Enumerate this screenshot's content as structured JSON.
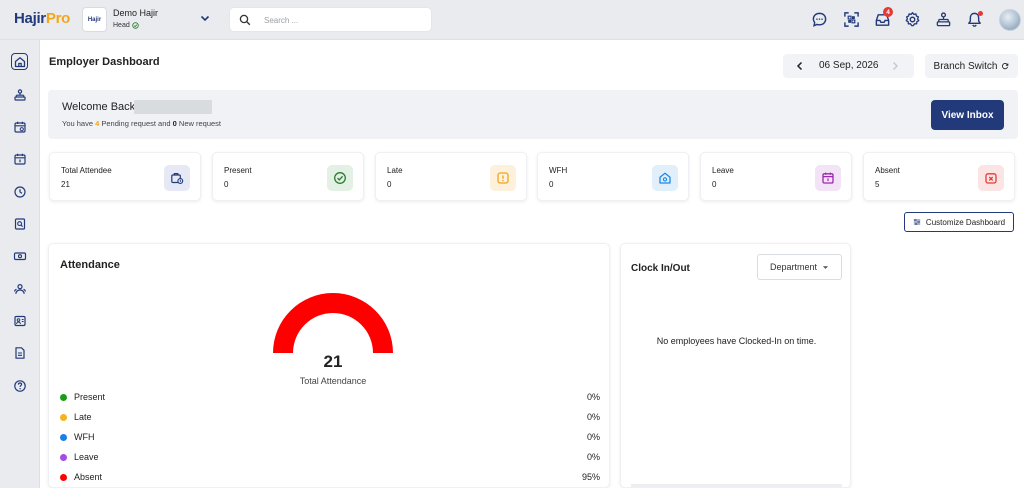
{
  "brand": {
    "logo_main": "Hajir",
    "logo_pro": "Pro"
  },
  "org": {
    "badge": "Hajir",
    "name": "Demo Hajir",
    "role": "Head"
  },
  "search": {
    "placeholder": "Search ..."
  },
  "notifications": {
    "inbox_count": "4"
  },
  "page": {
    "title": "Employer Dashboard"
  },
  "date_nav": {
    "date": "06 Sep, 2026"
  },
  "branch": {
    "label": "Branch Switch"
  },
  "welcome": {
    "greeting": "Welcome Back,",
    "prefix": "You have ",
    "pending_count": "4",
    "middle": " Pending request and ",
    "new_count": "0",
    "suffix": " New request",
    "inbox_button": "View Inbox"
  },
  "stats": [
    {
      "label": "Total Attendee",
      "value": "21",
      "icon": "briefcase-clock-icon",
      "color": "#233a7a",
      "bg": "#e6e9f5"
    },
    {
      "label": "Present",
      "value": "0",
      "icon": "check-circle-icon",
      "color": "#2e7d32",
      "bg": "#e3f0e4"
    },
    {
      "label": "Late",
      "value": "0",
      "icon": "alert-icon",
      "color": "#f3a51c",
      "bg": "#fdf1dc"
    },
    {
      "label": "WFH",
      "value": "0",
      "icon": "home-icon",
      "color": "#1e88e5",
      "bg": "#e1effb"
    },
    {
      "label": "Leave",
      "value": "0",
      "icon": "calendar-icon",
      "color": "#9c27b0",
      "bg": "#f2e3f6"
    },
    {
      "label": "Absent",
      "value": "5",
      "icon": "calendar-x-icon",
      "color": "#e53935",
      "bg": "#fbe4e4"
    }
  ],
  "customize": {
    "label": "Customize Dashboard"
  },
  "attendance": {
    "title": "Attendance",
    "total": "21",
    "total_label": "Total Attendance",
    "gauge_color": "#ff0000",
    "legend": [
      {
        "name": "Present",
        "pct": "0%",
        "color": "#1a9c1a"
      },
      {
        "name": "Late",
        "pct": "0%",
        "color": "#f3b41c"
      },
      {
        "name": "WFH",
        "pct": "0%",
        "color": "#1e7ee5"
      },
      {
        "name": "Leave",
        "pct": "0%",
        "color": "#a64de0"
      },
      {
        "name": "Absent",
        "pct": "95%",
        "color": "#ff0000"
      }
    ]
  },
  "clock": {
    "title": "Clock In/Out",
    "department": "Department",
    "empty_message": "No employees have Clocked-In on time."
  },
  "colors": {
    "brand": "#233a7a",
    "accent": "#f3a51c"
  }
}
